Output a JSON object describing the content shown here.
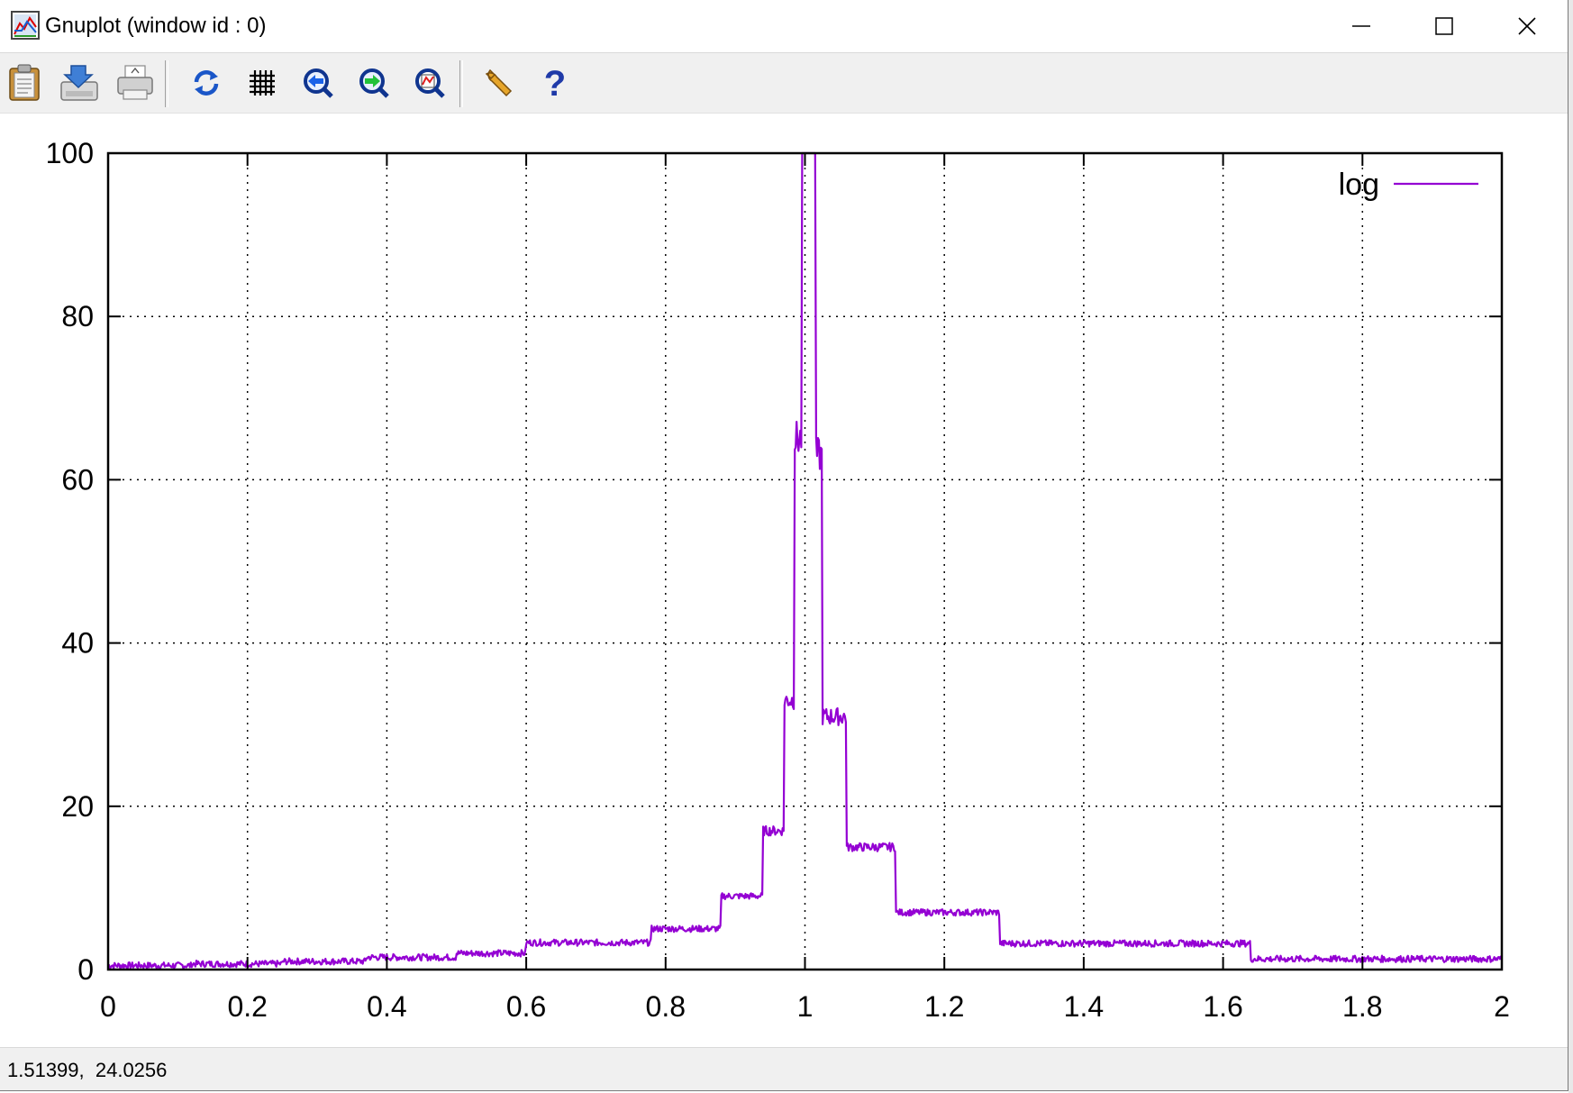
{
  "window": {
    "title": "Gnuplot (window id : 0)"
  },
  "titlebar_buttons": {
    "minimize": "minimize-icon",
    "maximize": "maximize-icon",
    "close": "close-icon"
  },
  "toolbar": {
    "icons": [
      "clipboard-icon",
      "save-icon",
      "print-icon",
      "replot-icon",
      "grid-icon",
      "zoom-back-icon",
      "zoom-forward-icon",
      "unzoom-icon",
      "options-wrench-icon",
      "help-icon"
    ]
  },
  "status": {
    "coords": "1.51399,  24.0256"
  },
  "colors": {
    "series": "#9400d3",
    "grid": "#000000"
  },
  "chart_data": {
    "type": "line",
    "title": "",
    "xlabel": "",
    "ylabel": "",
    "xlim": [
      0,
      2
    ],
    "ylim": [
      0,
      100
    ],
    "x_ticks": [
      0,
      0.2,
      0.4,
      0.6,
      0.8,
      1,
      1.2,
      1.4,
      1.6,
      1.8,
      2
    ],
    "x_tick_labels": [
      "0",
      "0.2",
      "0.4",
      "0.6",
      "0.8",
      "1",
      "1.2",
      "1.4",
      "1.6",
      "1.8",
      "2"
    ],
    "y_ticks": [
      0,
      20,
      40,
      60,
      80,
      100
    ],
    "y_tick_labels": [
      "0",
      "20",
      "40",
      "60",
      "80",
      "100"
    ],
    "grid": true,
    "legend_position": "top-right",
    "series": [
      {
        "name": "log",
        "steps": [
          [
            0.0,
            0.5
          ],
          [
            0.12,
            0.7
          ],
          [
            0.25,
            1.0
          ],
          [
            0.37,
            1.5
          ],
          [
            0.5,
            2.0
          ],
          [
            0.6,
            3.3
          ],
          [
            0.78,
            5.0
          ],
          [
            0.88,
            9.0
          ],
          [
            0.94,
            17.0
          ],
          [
            0.97,
            33.0
          ],
          [
            0.985,
            65.0
          ],
          [
            0.995,
            100.0
          ],
          [
            1.015,
            63.0
          ],
          [
            1.025,
            31.0
          ],
          [
            1.06,
            15.0
          ],
          [
            1.13,
            7.0
          ],
          [
            1.28,
            3.2
          ],
          [
            1.64,
            1.3
          ],
          [
            2.0,
            1.3
          ]
        ]
      }
    ]
  }
}
